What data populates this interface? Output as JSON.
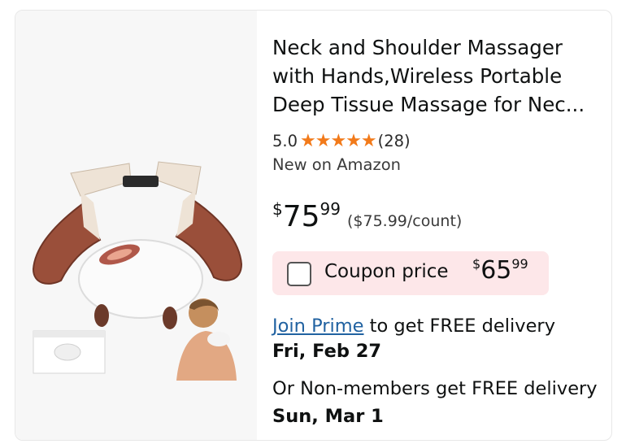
{
  "product": {
    "title": "Neck and Shoulder Massager with Hands,Wireless Portable Deep Tissue Massage for Nec...",
    "rating": "5.0",
    "stars": "★★★★★",
    "review_count": "(28)",
    "condition_note": "New on Amazon",
    "price": {
      "currency": "$",
      "whole": "75",
      "fraction": "99",
      "per_unit": "($75.99/count)"
    },
    "coupon": {
      "label": "Coupon price",
      "currency": "$",
      "whole": "65",
      "fraction": "99",
      "checked": false
    },
    "delivery": {
      "prime_link": "Join Prime",
      "prime_text": " to get FREE delivery",
      "prime_date": "Fri, Feb 27",
      "nonmember_text": "Or Non-members get FREE delivery ",
      "nonmember_date": "Sun, Mar 1"
    },
    "image": {
      "subject": "neck-and-shoulder-massager"
    }
  },
  "colors": {
    "star": "#f27a1a",
    "link": "#2162a1",
    "coupon_bg": "#fde7e9",
    "image_bg": "#f7f7f7"
  }
}
